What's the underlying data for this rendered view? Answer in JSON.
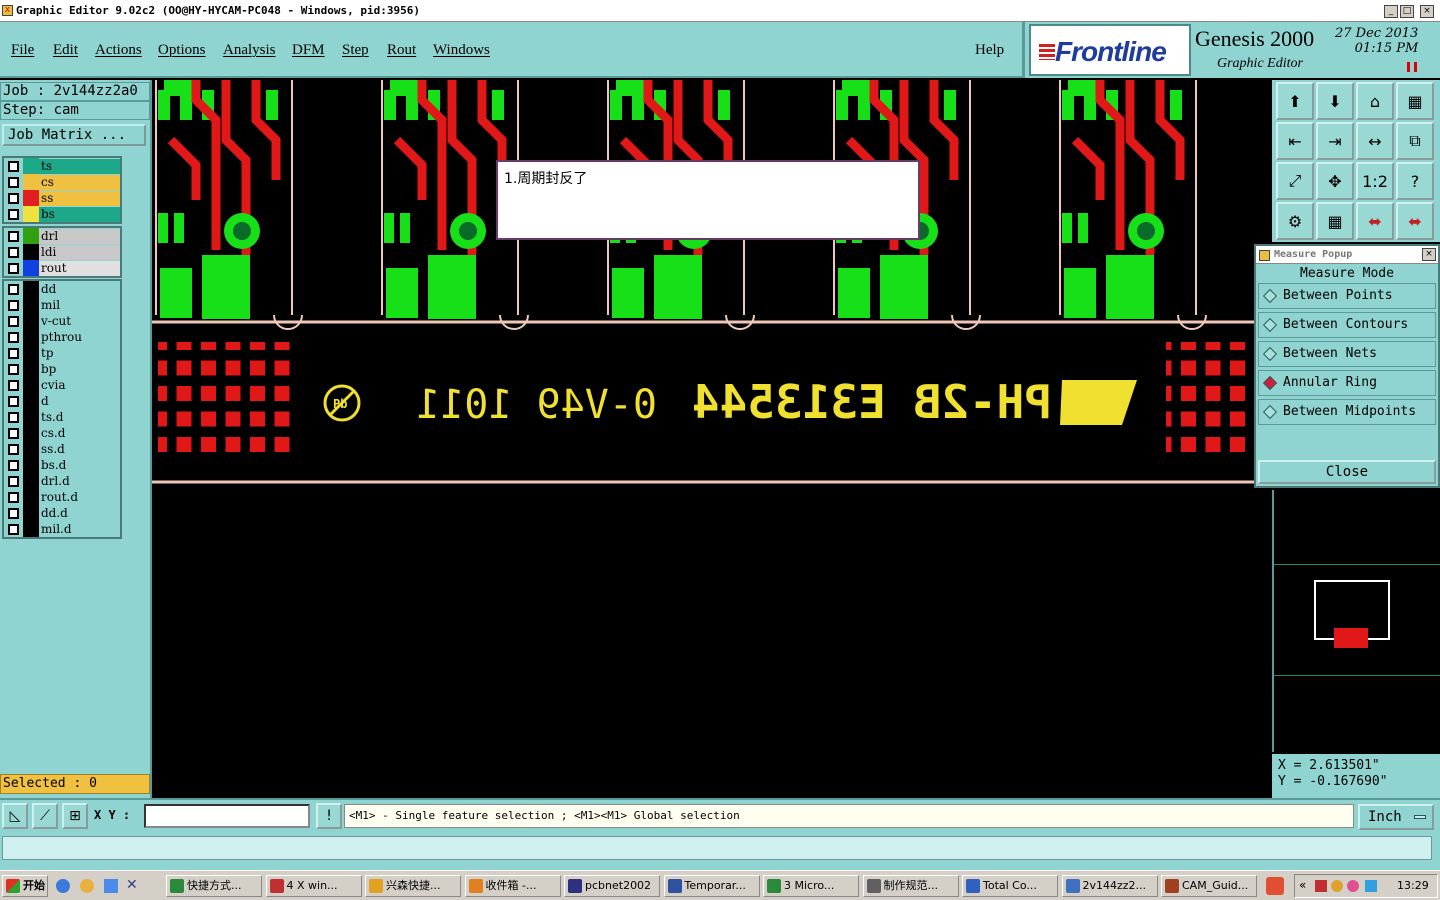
{
  "window": {
    "title": "Graphic Editor 9.02c2  (OO@HY-HYCAM-PC048 - Windows, pid:3956)",
    "controls": [
      "_",
      "□",
      "×"
    ]
  },
  "menu": {
    "items": [
      "File",
      "Edit",
      "Actions",
      "Options",
      "Analysis",
      "DFM",
      "Step",
      "Rout",
      "Windows"
    ],
    "help": "Help"
  },
  "brand": {
    "logo": "Frontline",
    "product": "Genesis 2000",
    "subtitle": "Graphic Editor",
    "date": "27 Dec 2013",
    "time": "01:15 PM"
  },
  "info": {
    "job": "Job : 2v144zz2a0",
    "step": "Step: cam",
    "job_matrix": "Job Matrix ..."
  },
  "layers_board": [
    {
      "name": "ts",
      "color": "#1ea88a",
      "fill": "#1ea88a"
    },
    {
      "name": "cs",
      "color": "#f0c040",
      "fill": "#f0c040"
    },
    {
      "name": "ss",
      "color": "#e02020",
      "fill": "#f0c040"
    },
    {
      "name": "bs",
      "color": "#f0e040",
      "fill": "#1ea88a"
    }
  ],
  "layers_drill": [
    {
      "name": "drl",
      "color": "#30a010",
      "fill": "#c8c8c8"
    },
    {
      "name": "ldi",
      "color": "#000000",
      "fill": "#c8c8c8"
    },
    {
      "name": "rout",
      "color": "#1040e0",
      "fill": "#e0e0e0"
    }
  ],
  "layers_misc": [
    "dd",
    "mil",
    "v-cut",
    "pthrou",
    "tp",
    "bp",
    "cvia",
    "d",
    "ts.d",
    "cs.d",
    "ss.d",
    "bs.d",
    "drl.d",
    "rout.d",
    "dd.d",
    "mil.d"
  ],
  "selected": "Selected : 0",
  "note": {
    "text": "1.周期封反了"
  },
  "silkscreen": {
    "left": "0-V49  1011",
    "right": "PH-2B E313544"
  },
  "measure": {
    "title": "Measure Popup",
    "mode_label": "Measure Mode",
    "options": [
      "Between Points",
      "Between Contours",
      "Between Nets",
      "Annular Ring",
      "Between Midpoints"
    ],
    "active": "Annular Ring",
    "close": "Close"
  },
  "coords": {
    "x": "X = 2.613501\"",
    "y": "Y = -0.167690\""
  },
  "command": {
    "xy_label": "X Y :",
    "xy_value": "",
    "message": "<M1> - Single feature selection ; <M1><M1> Global selection",
    "unit": "Inch"
  },
  "taskbar": {
    "start": "开始",
    "tasks": [
      "快捷方式...",
      "4 X win...",
      "兴森快捷...",
      "收件箱 -...",
      "pcbnet2002",
      "Temporar...",
      "3 Micro...",
      "制作规范...",
      "Total Co...",
      "2v144zz2...",
      "CAM_Guid..."
    ],
    "clock": "13:29"
  }
}
